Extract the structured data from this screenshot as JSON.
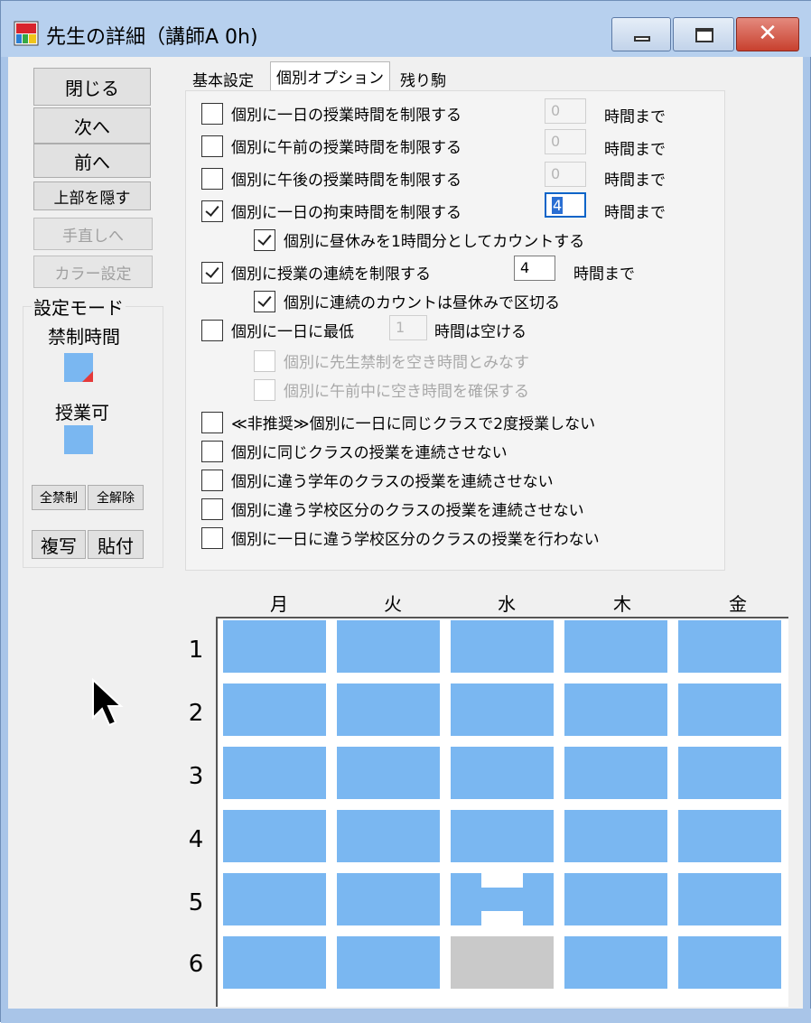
{
  "window": {
    "title": "先生の詳細（講師A 0h)",
    "close_glyph": "✕"
  },
  "left_buttons": {
    "close": "閉じる",
    "next": "次へ",
    "prev": "前へ",
    "hide_top": "上部を隠す",
    "adjust": "手直しへ",
    "color": "カラー設定"
  },
  "mode": {
    "title": "設定モード",
    "forbidden_label": "禁制時間",
    "allowed_label": "授業可",
    "all_forbid": "全禁制",
    "all_release": "全解除",
    "copy": "複写",
    "paste": "貼付",
    "colors": {
      "allowed": "#7ab7f1",
      "forbidden_mark": "#e53a3a"
    }
  },
  "tabs": [
    "基本設定",
    "個別オプション",
    "残り駒"
  ],
  "options": [
    {
      "label": "個別に一日の授業時間を制限する",
      "checked": false,
      "value": "0",
      "unit": "時間まで"
    },
    {
      "label": "個別に午前の授業時間を制限する",
      "checked": false,
      "value": "0",
      "unit": "時間まで"
    },
    {
      "label": "個別に午後の授業時間を制限する",
      "checked": false,
      "value": "0",
      "unit": "時間まで"
    },
    {
      "label": "個別に一日の拘束時間を制限する",
      "checked": true,
      "value": "4",
      "unit": "時間まで"
    },
    {
      "label": "個別に昼休みを1時間分としてカウントする",
      "checked": true
    },
    {
      "label": "個別に授業の連続を制限する",
      "checked": true,
      "value": "4",
      "unit": "時間まで"
    },
    {
      "label": "個別に連続のカウントは昼休みで区切る",
      "checked": true
    },
    {
      "label": "個別に一日に最低",
      "checked": false,
      "value": "1",
      "unit": "時間は空ける"
    },
    {
      "label": "個別に先生禁制を空き時間とみなす",
      "checked": false
    },
    {
      "label": "個別に午前中に空き時間を確保する",
      "checked": false
    },
    {
      "label": "≪非推奨≫個別に一日に同じクラスで2度授業しない",
      "checked": false
    },
    {
      "label": "個別に同じクラスの授業を連続させない",
      "checked": false
    },
    {
      "label": "個別に違う学年のクラスの授業を連続させない",
      "checked": false
    },
    {
      "label": "個別に違う学校区分のクラスの授業を連続させない",
      "checked": false
    },
    {
      "label": "個別に一日に違う学校区分のクラスの授業を行わない",
      "checked": false
    }
  ],
  "timetable": {
    "days": [
      "月",
      "火",
      "水",
      "木",
      "金"
    ],
    "periods": [
      "1",
      "2",
      "3",
      "4",
      "5",
      "6"
    ]
  }
}
